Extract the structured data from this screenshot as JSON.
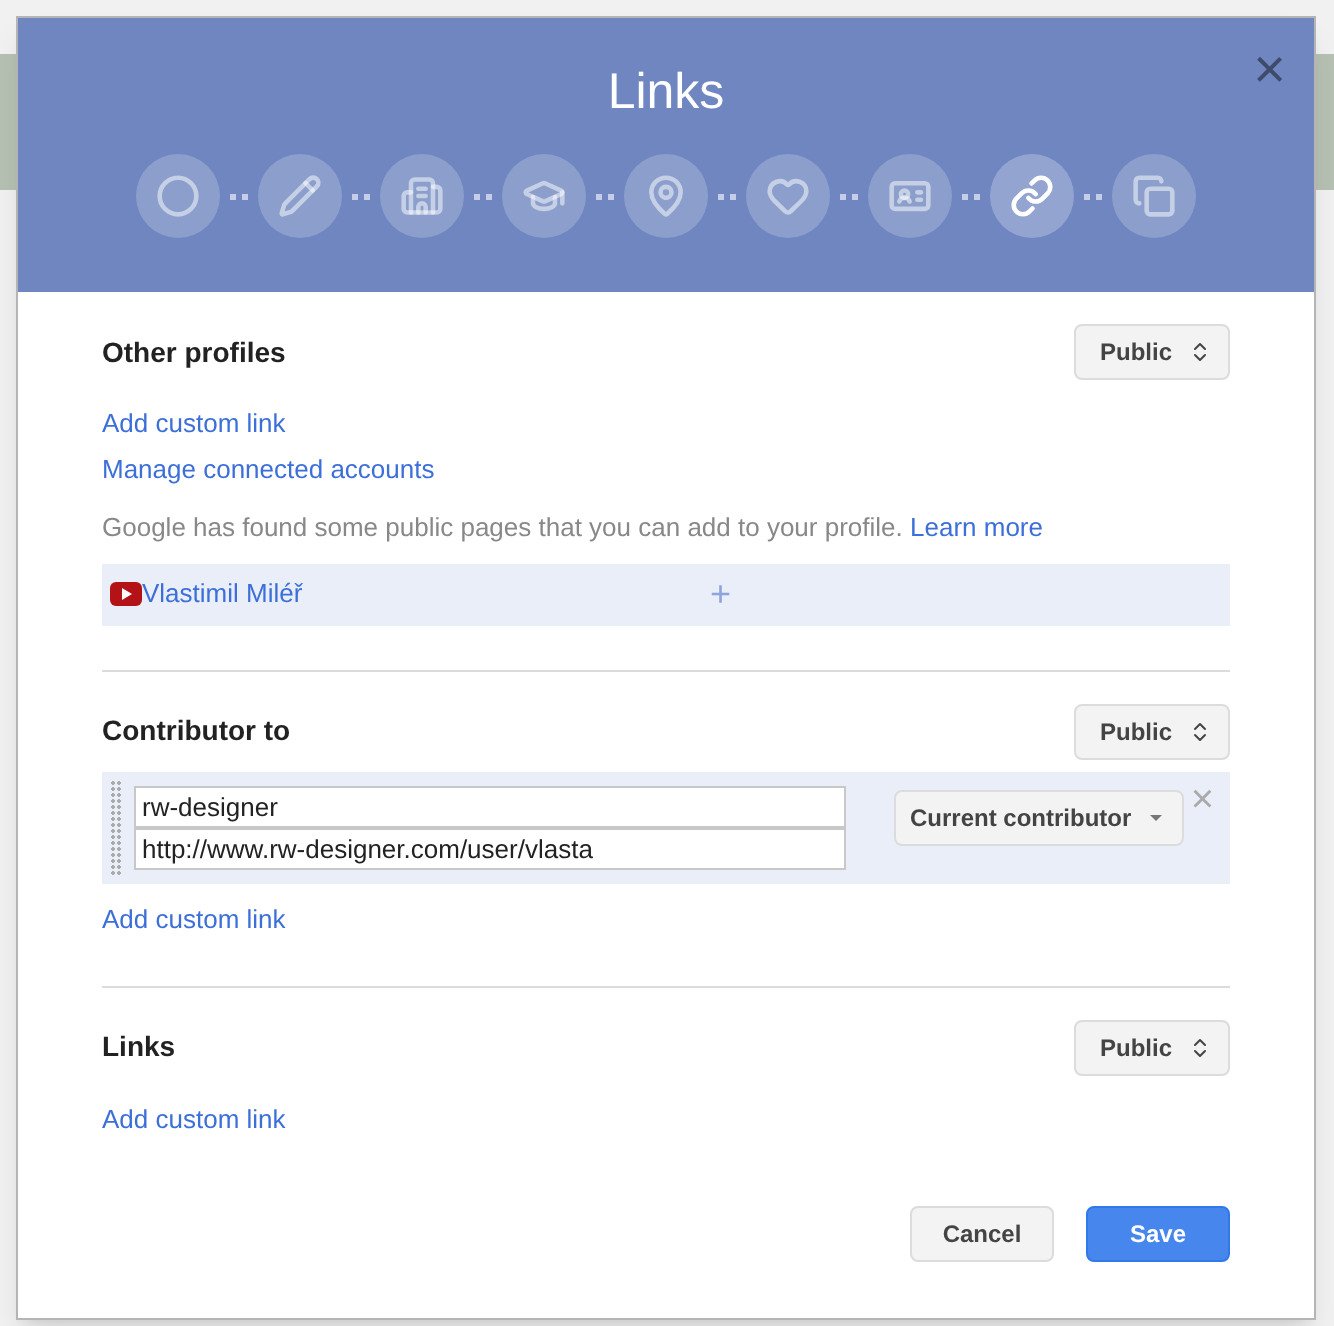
{
  "dialog": {
    "title": "Links",
    "close": "×"
  },
  "steps": [
    {
      "kind": "circles",
      "selected": false
    },
    {
      "kind": "pencil",
      "selected": false
    },
    {
      "kind": "building",
      "selected": false
    },
    {
      "kind": "cap",
      "selected": false
    },
    {
      "kind": "pin",
      "selected": false
    },
    {
      "kind": "heart",
      "selected": false
    },
    {
      "kind": "card",
      "selected": false
    },
    {
      "kind": "link",
      "selected": true
    },
    {
      "kind": "stack",
      "selected": false
    }
  ],
  "sections": [
    {
      "title": "Other profiles",
      "visibility": "Public",
      "links": [
        "Add custom link",
        "Manage connected accounts"
      ],
      "note": "Google has found some public pages that you can add to your profile.",
      "note_link": "Learn more",
      "suggestions": [
        {
          "name": "Vlastimil Miléř",
          "add": "+"
        }
      ]
    },
    {
      "title": "Contributor to",
      "visibility": "Public",
      "entries": [
        {
          "label": "rw-designer",
          "url": "http://www.rw-designer.com/user/vlasta",
          "status": "Current contributor",
          "remove": "×"
        }
      ],
      "links": [
        "Add custom link"
      ]
    },
    {
      "title": "Links",
      "visibility": "Public",
      "links": [
        "Add custom link"
      ]
    }
  ],
  "buttons": [
    {
      "label": "Cancel",
      "kind": "secondary"
    },
    {
      "label": "Save",
      "kind": "primary"
    }
  ]
}
